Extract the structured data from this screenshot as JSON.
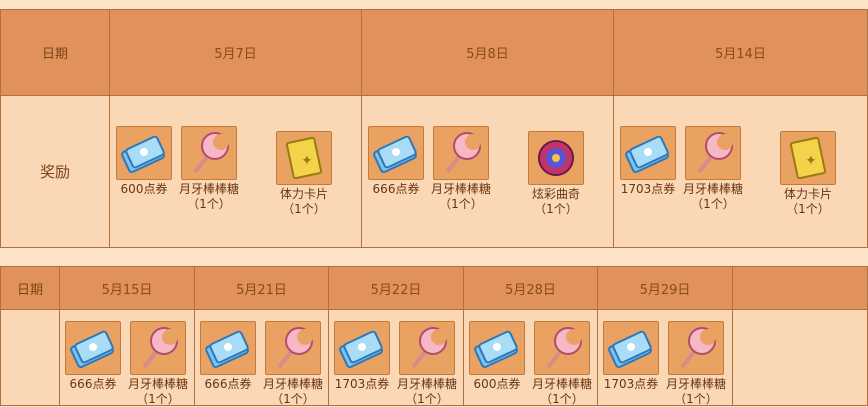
{
  "top_table": {
    "date_header": "日期",
    "reward_label": "奖励",
    "columns": [
      {
        "date": "5月7日",
        "items": [
          {
            "icon": "ticket-icon",
            "name": "600点券",
            "qty": ""
          },
          {
            "icon": "lollipop-icon",
            "name": "月牙棒棒糖",
            "qty": "（1个）"
          },
          {
            "icon": "card-icon",
            "name": "体力卡片",
            "qty": "（1个）"
          }
        ]
      },
      {
        "date": "5月8日",
        "items": [
          {
            "icon": "ticket-icon",
            "name": "666点券",
            "qty": ""
          },
          {
            "icon": "lollipop-icon",
            "name": "月牙棒棒糖",
            "qty": "（1个）"
          },
          {
            "icon": "cookie-icon",
            "name": "炫彩曲奇",
            "qty": "（1个）"
          }
        ]
      },
      {
        "date": "5月14日",
        "items": [
          {
            "icon": "ticket-icon",
            "name": "1703点券",
            "qty": ""
          },
          {
            "icon": "lollipop-icon",
            "name": "月牙棒棒糖",
            "qty": "（1个）"
          },
          {
            "icon": "card-icon",
            "name": "体力卡片",
            "qty": "（1个）"
          }
        ]
      }
    ]
  },
  "bottom_table": {
    "date_header": "日期",
    "columns": [
      {
        "date": "5月15日",
        "items": [
          {
            "icon": "ticket-icon",
            "name": "666点券",
            "qty": ""
          },
          {
            "icon": "lollipop-icon",
            "name": "月牙棒棒糖",
            "qty": "（1个）"
          }
        ]
      },
      {
        "date": "5月21日",
        "items": [
          {
            "icon": "ticket-icon",
            "name": "666点券",
            "qty": ""
          },
          {
            "icon": "lollipop-icon",
            "name": "月牙棒棒糖",
            "qty": "（1个）"
          }
        ]
      },
      {
        "date": "5月22日",
        "items": [
          {
            "icon": "ticket-icon",
            "name": "1703点券",
            "qty": ""
          },
          {
            "icon": "lollipop-icon",
            "name": "月牙棒棒糖",
            "qty": "（1个）"
          }
        ]
      },
      {
        "date": "5月28日",
        "items": [
          {
            "icon": "ticket-icon",
            "name": "600点券",
            "qty": ""
          },
          {
            "icon": "lollipop-icon",
            "name": "月牙棒棒糖",
            "qty": "（1个）"
          }
        ]
      },
      {
        "date": "5月29日",
        "items": [
          {
            "icon": "ticket-icon",
            "name": "1703点券",
            "qty": ""
          },
          {
            "icon": "lollipop-icon",
            "name": "月牙棒棒糖",
            "qty": "（1个）"
          }
        ]
      }
    ]
  },
  "colors": {
    "header_bg": "#e0925a",
    "body_bg": "#fad8b6",
    "border": "#b3703a",
    "text": "#8a4b1a"
  }
}
